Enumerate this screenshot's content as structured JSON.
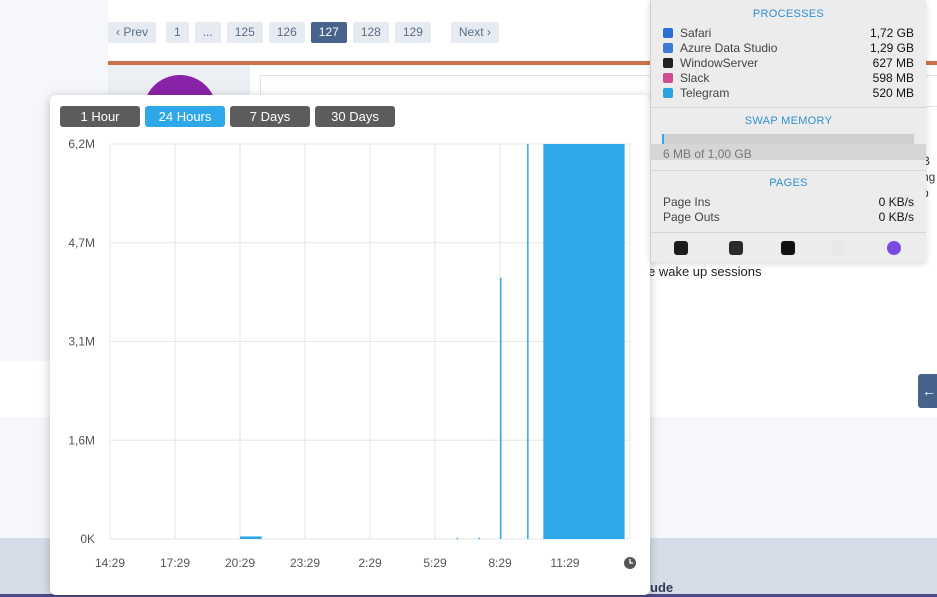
{
  "pager": {
    "prev": "‹ Prev",
    "pages": [
      "1",
      "...",
      "125",
      "126",
      "127",
      "128",
      "129"
    ],
    "current": "127",
    "next": "Next ›"
  },
  "post": {
    "snippet": "e wake up sessions",
    "clipped_lines": [
      "B",
      "ng",
      "p"
    ]
  },
  "footer": {
    "text": "ude"
  },
  "chart_tabs": [
    {
      "label": "1 Hour",
      "active": false
    },
    {
      "label": "24 Hours",
      "active": true
    },
    {
      "label": "7 Days",
      "active": false
    },
    {
      "label": "30 Days",
      "active": false
    }
  ],
  "chart_data": {
    "type": "bar",
    "title": "",
    "xlabel": "",
    "ylabel": "",
    "y_ticks": [
      "6,2M",
      "4,7M",
      "3,1M",
      "1,6M",
      "0K"
    ],
    "x_ticks": [
      "14:29",
      "17:29",
      "20:29",
      "23:29",
      "2:29",
      "5:29",
      "8:29",
      "11:29"
    ],
    "ylim": [
      0,
      6200000
    ],
    "grid": true,
    "color": "#2ea8e8",
    "series": [
      {
        "values": [
          {
            "t": "20:29",
            "t_end": "21:29",
            "value": 40000
          },
          {
            "t": "6:29",
            "value": 20000
          },
          {
            "t": "7:29",
            "value": 20000
          },
          {
            "t": "8:29",
            "value": 4100000
          },
          {
            "t": "9:44",
            "value": 6200000
          },
          {
            "t": "10:29",
            "t_end": "14:14",
            "value": 6200000
          }
        ]
      }
    ],
    "clock_icon": "clock-icon"
  },
  "activity": {
    "processes_title": "PROCESSES",
    "processes": [
      {
        "name": "Safari",
        "value": "1,72 GB",
        "icon": "safari-icon",
        "color": "#2a6fd6"
      },
      {
        "name": "Azure Data Studio",
        "value": "1,29 GB",
        "icon": "azure-data-studio-icon",
        "color": "#3a7bd5"
      },
      {
        "name": "WindowServer",
        "value": "627 MB",
        "icon": "windowserver-icon",
        "color": "#222222"
      },
      {
        "name": "Slack",
        "value": "598 MB",
        "icon": "slack-icon",
        "color": "#d14b8f"
      },
      {
        "name": "Telegram",
        "value": "520 MB",
        "icon": "telegram-icon",
        "color": "#2aa3e0"
      }
    ],
    "swap_title": "SWAP MEMORY",
    "swap_text": "6 MB of 1,00 GB",
    "swap_fraction": 0.006,
    "pages_title": "PAGES",
    "pages": [
      {
        "name": "Page Ins",
        "value": "0 KB/s"
      },
      {
        "name": "Page Outs",
        "value": "0 KB/s"
      }
    ],
    "dock": [
      {
        "icon": "activity-monitor-icon",
        "color": "#1d1d1d"
      },
      {
        "icon": "console-icon",
        "color": "#2b2b2b"
      },
      {
        "icon": "terminal-icon",
        "color": "#111111"
      },
      {
        "icon": "disk-utility-icon",
        "color": "#e8e8e8"
      },
      {
        "icon": "firefox-icon",
        "color": "#7a4be0"
      }
    ]
  }
}
